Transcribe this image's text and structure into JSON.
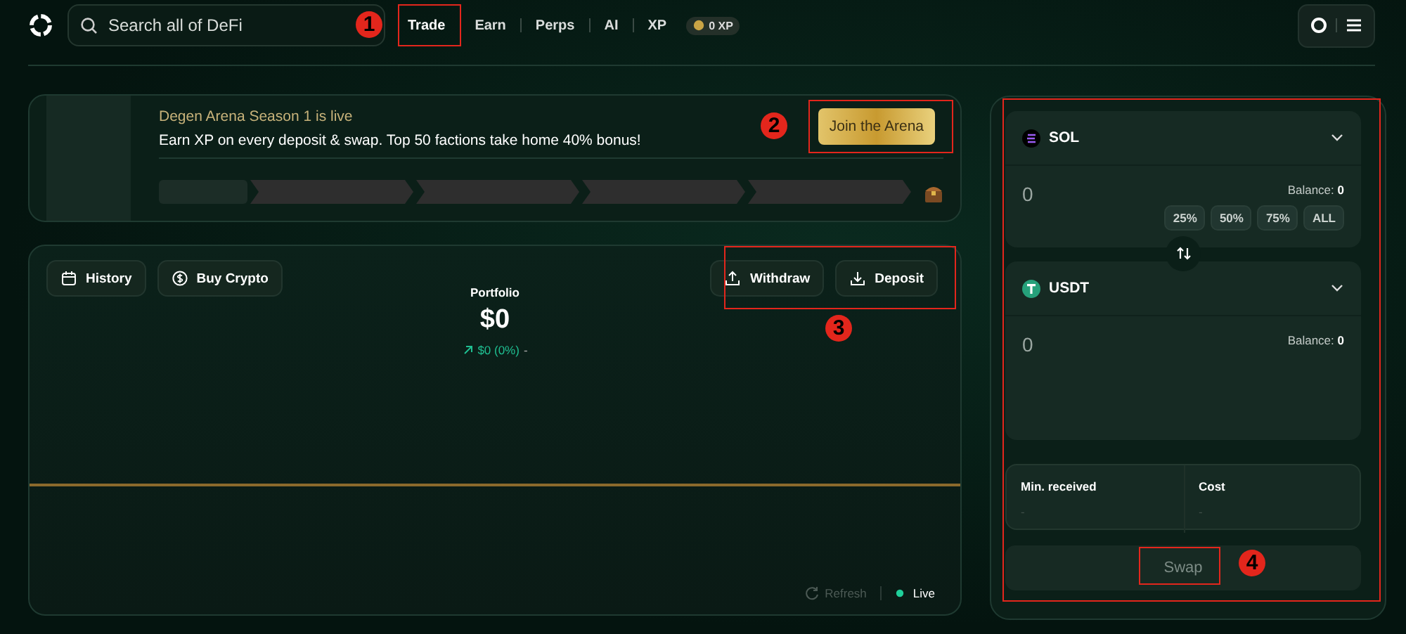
{
  "header": {
    "search": {
      "placeholder": "Search all of DeFi"
    },
    "nav": [
      {
        "label": "Trade",
        "selected": true
      },
      {
        "label": "Earn",
        "selected": false
      },
      {
        "label": "Perps",
        "selected": false
      },
      {
        "label": "AI",
        "selected": false
      },
      {
        "label": "XP",
        "selected": false
      }
    ],
    "xp_badge": "0 XP"
  },
  "banner": {
    "title": "Degen Arena Season 1 is live",
    "text": "Earn XP on every deposit & swap. Top 50 factions take home 40% bonus!",
    "button": "Join the Arena"
  },
  "portfolio": {
    "left_buttons": [
      "History",
      "Buy Crypto"
    ],
    "right_buttons": [
      "Withdraw",
      "Deposit"
    ],
    "label": "Portfolio",
    "value": "$0",
    "change": "$0 (0%)",
    "change_suffix": "-",
    "refresh": "Refresh",
    "live": "Live"
  },
  "swap": {
    "from": {
      "token": "SOL",
      "amount": "0",
      "balance_label": "Balance:",
      "balance": "0",
      "presets": [
        "25%",
        "50%",
        "75%",
        "ALL"
      ]
    },
    "to": {
      "token": "USDT",
      "amount": "0",
      "balance_label": "Balance:",
      "balance": "0"
    },
    "summary": [
      {
        "label": "Min. received",
        "value": "-"
      },
      {
        "label": "Cost",
        "value": "-"
      }
    ],
    "button": {
      "label": "Swap",
      "disabled": true
    }
  },
  "annotations": [
    {
      "number": "1"
    },
    {
      "number": "2"
    },
    {
      "number": "3"
    },
    {
      "number": "4"
    }
  ]
}
